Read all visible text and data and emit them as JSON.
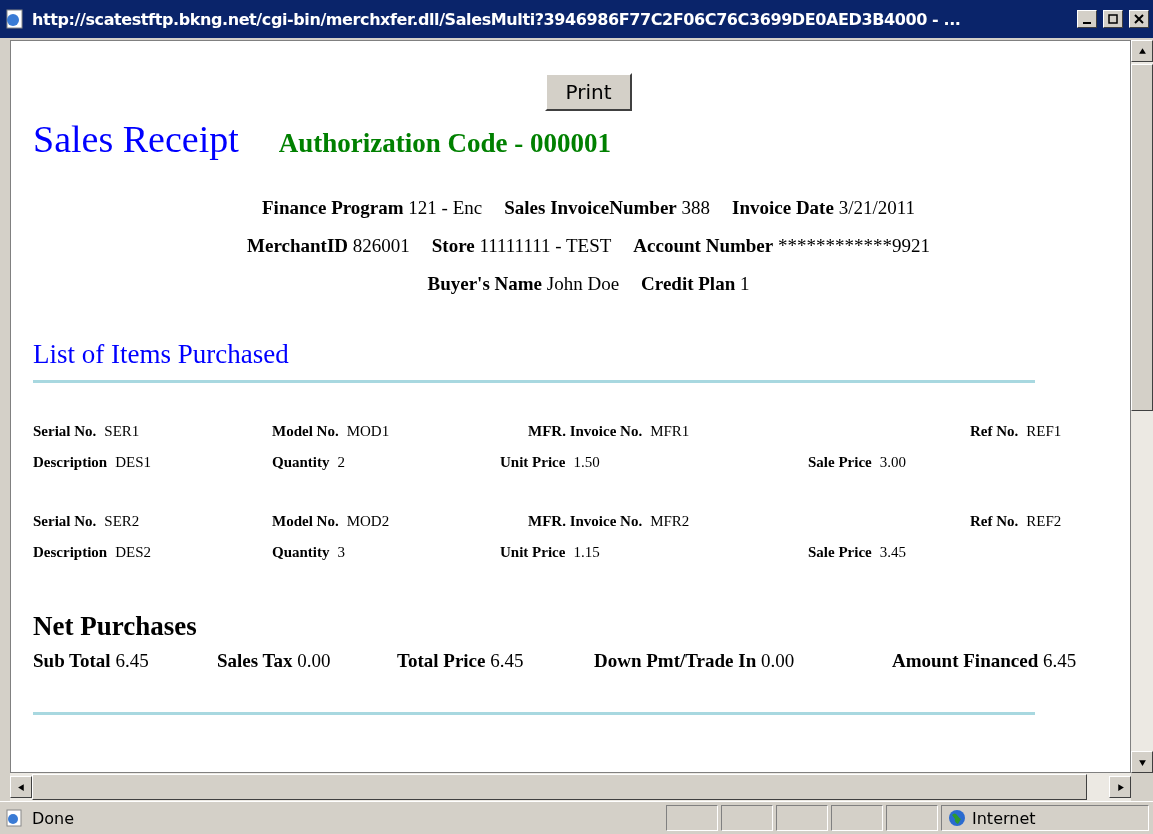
{
  "window": {
    "title": "http://scatestftp.bkng.net/cgi-bin/merchxfer.dll/SalesMulti?3946986F77C2F06C76C3699DE0AED3B4000 - ..."
  },
  "print_button": "Print",
  "heading": "Sales Receipt",
  "authorization": "Authorization Code - 000001",
  "info_rows": [
    [
      {
        "label": "Finance Program",
        "value": "121 - Enc"
      },
      {
        "label": "Sales InvoiceNumber",
        "value": "388"
      },
      {
        "label": "Invoice Date",
        "value": "3/21/2011"
      }
    ],
    [
      {
        "label": "MerchantID",
        "value": "826001"
      },
      {
        "label": "Store",
        "value": "11111111 - TEST"
      },
      {
        "label": "Account Number",
        "value": "************9921"
      }
    ],
    [
      {
        "label": "Buyer's Name",
        "value": "John Doe"
      },
      {
        "label": "Credit Plan",
        "value": "1"
      }
    ]
  ],
  "items_heading": "List of Items Purchased",
  "items": [
    {
      "fields": [
        {
          "label": "Serial No.",
          "value": "SER1"
        },
        {
          "label": "Model No.",
          "value": "MOD1"
        },
        {
          "label": "MFR. Invoice No.",
          "value": "MFR1"
        },
        {
          "label": "Ref No.",
          "value": "REF1"
        },
        {
          "label": "Description",
          "value": "DES1"
        },
        {
          "label": "Quantity",
          "value": "2"
        },
        {
          "label": "Unit Price",
          "value": "1.50"
        },
        {
          "label": "Sale Price",
          "value": "3.00"
        }
      ]
    },
    {
      "fields": [
        {
          "label": "Serial No.",
          "value": "SER2"
        },
        {
          "label": "Model No.",
          "value": "MOD2"
        },
        {
          "label": "MFR. Invoice No.",
          "value": "MFR2"
        },
        {
          "label": "Ref No.",
          "value": "REF2"
        },
        {
          "label": "Description",
          "value": "DES2"
        },
        {
          "label": "Quantity",
          "value": "3"
        },
        {
          "label": "Unit Price",
          "value": "1.15"
        },
        {
          "label": "Sale Price",
          "value": "3.45"
        }
      ]
    }
  ],
  "net_heading": "Net Purchases",
  "totals": [
    {
      "label": "Sub Total",
      "value": "6.45"
    },
    {
      "label": "Sales Tax",
      "value": "0.00"
    },
    {
      "label": "Total Price",
      "value": "6.45"
    },
    {
      "label": "Down Pmt/Trade In",
      "value": "0.00"
    },
    {
      "label": "Amount Financed",
      "value": "6.45"
    }
  ],
  "status_bar": {
    "text": "Done",
    "zone": "Internet"
  }
}
